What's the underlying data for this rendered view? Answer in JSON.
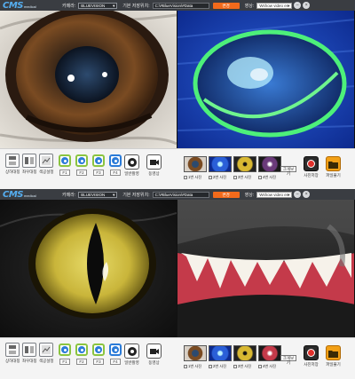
{
  "app": {
    "logo_text": "CMS",
    "logo_sub": "medical"
  },
  "topbar": {
    "camera_label": "카메라:",
    "camera_value": "BLUEVISION",
    "save_label": "기본 저장위치:",
    "save_path": "C:\\#BlueVision\\#Data",
    "change_button": "변경",
    "video_label": "영상:",
    "video_value": "Wshow video en"
  },
  "toolbar": {
    "tools": [
      {
        "label": "상하대칭",
        "icon": "flip-vertical-icon"
      },
      {
        "label": "좌우대칭",
        "icon": "flip-horizontal-icon"
      },
      {
        "label": "색공설정",
        "icon": "color-settings-icon"
      }
    ],
    "fkeys": [
      "F1",
      "F2",
      "F3",
      "F4"
    ],
    "capture_label": "일반촬영",
    "video_rec_label": "동영상",
    "thumbs": [
      {
        "label": "1번 사진"
      },
      {
        "label": "2번 사진"
      },
      {
        "label": "3번 사진"
      },
      {
        "label": "4번 사진"
      }
    ],
    "zoom_label": "크게보기",
    "save_photo_label": "사진저장",
    "open_file_label": "파일불기"
  },
  "colors": {
    "accent_orange": "#f26a1b",
    "fkey_green": "#8bc440",
    "fkey_blue": "#2b7bd8",
    "record_red": "#e0302b",
    "topbar_bg": "#3a3d42"
  }
}
